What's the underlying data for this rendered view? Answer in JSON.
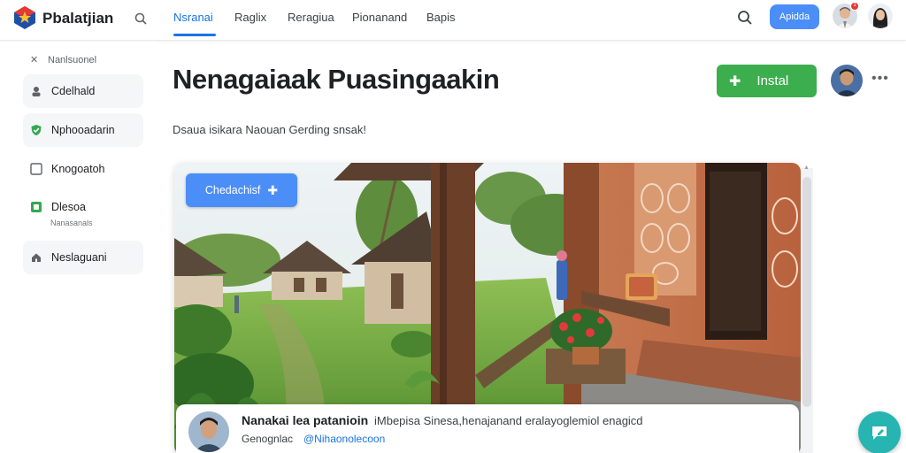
{
  "header": {
    "brand": "Pbalatjian",
    "tabs": [
      {
        "label": "Nsranai"
      },
      {
        "label": "Raglix"
      },
      {
        "label": "Reragiua"
      },
      {
        "label": "Pionanand"
      },
      {
        "label": "Bapis"
      }
    ],
    "active_tab": 0,
    "pill_label": "Apidda",
    "notification_count": "1"
  },
  "sidebar": {
    "header": "Nanlsuonel",
    "items": [
      {
        "label": "Cdelhald",
        "icon": "user-icon"
      },
      {
        "label": "Nphooadarin",
        "icon": "shield-check-icon"
      },
      {
        "label": "Knogoatoh",
        "icon": "checkbox-icon"
      },
      {
        "label": "Dlesoa",
        "sub": "Nanasanals",
        "icon": "green-square-icon"
      },
      {
        "label": "Neslaguani",
        "icon": "home-icon"
      }
    ]
  },
  "main": {
    "title": "Nenagaiaak Puasingaakin",
    "subtitle": "Dsaua isikara Naouan Gerding snsak!",
    "install_label": "Instal",
    "overlay_button_label": "Chedachisf"
  },
  "info": {
    "name": "Nanakai lea patanioin",
    "description": "iMbepisa Sinesa,henajanand eralayoglemiol enagicd",
    "sub": "Genognlac",
    "link": "@Nihaonolecoon"
  },
  "colors": {
    "accent": "#1a73e8",
    "install": "#3cae4e",
    "pill": "#4c8ef7",
    "fab": "#26b5b0"
  }
}
